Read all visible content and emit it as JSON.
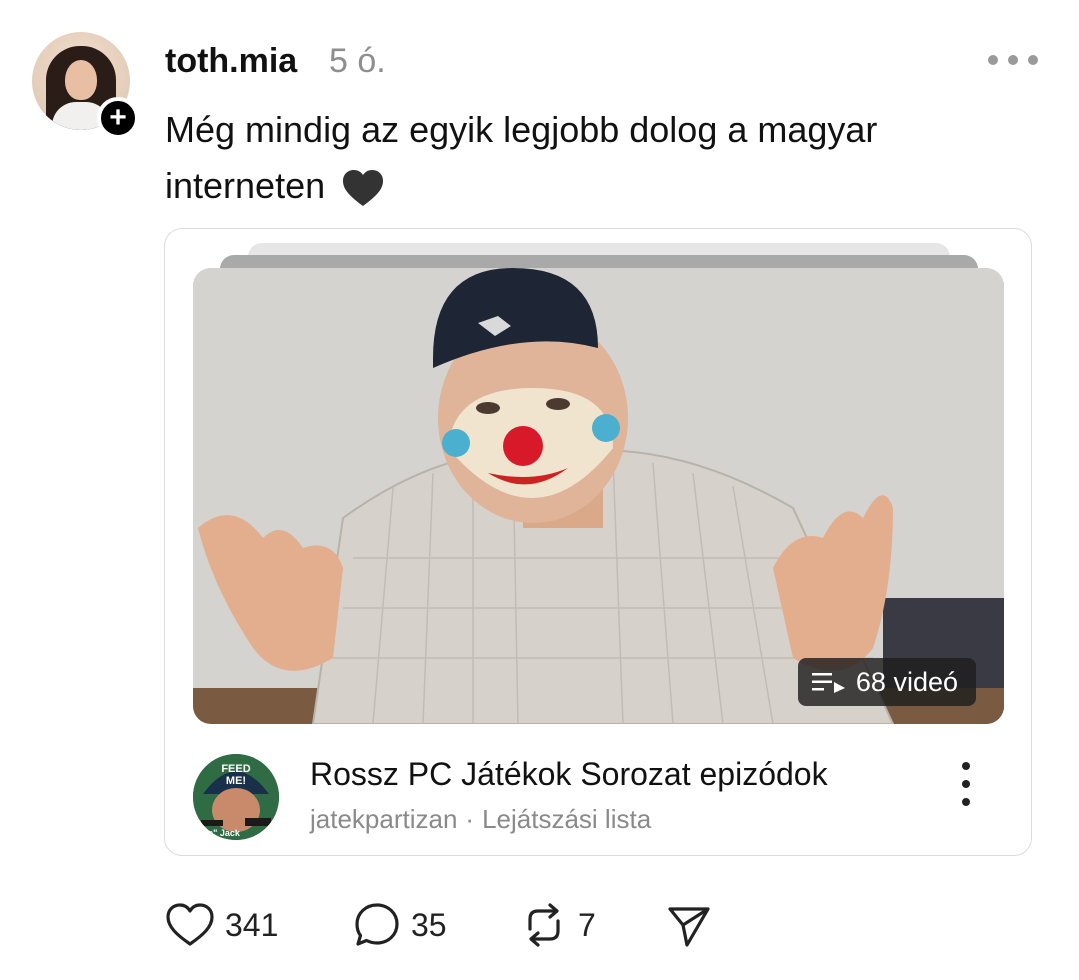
{
  "post": {
    "username": "toth.mia",
    "time": "5 ó.",
    "text": "Még mindig az egyik legjobb dolog a magyar interneten"
  },
  "playlist": {
    "title": "Rossz PC Játékok Sorozat epizódok",
    "channel": "jatekpartizan",
    "separator": "·",
    "kind": "Lejátszási lista",
    "video_count": "68 videó",
    "channel_avatar_text": [
      "FEED",
      "ME!",
      "bo\" Jack"
    ]
  },
  "actions": {
    "likes": "341",
    "comments": "35",
    "reposts": "7"
  },
  "icons": [
    "plus-icon",
    "more-horizontal-icon",
    "black-heart-emoji",
    "playlist-icon",
    "more-vertical-icon",
    "heart-icon",
    "comment-icon",
    "repost-icon",
    "share-icon"
  ],
  "colors": {
    "text": "#111111",
    "secondary": "#8e8e8e",
    "badge_bg": "#000000"
  }
}
